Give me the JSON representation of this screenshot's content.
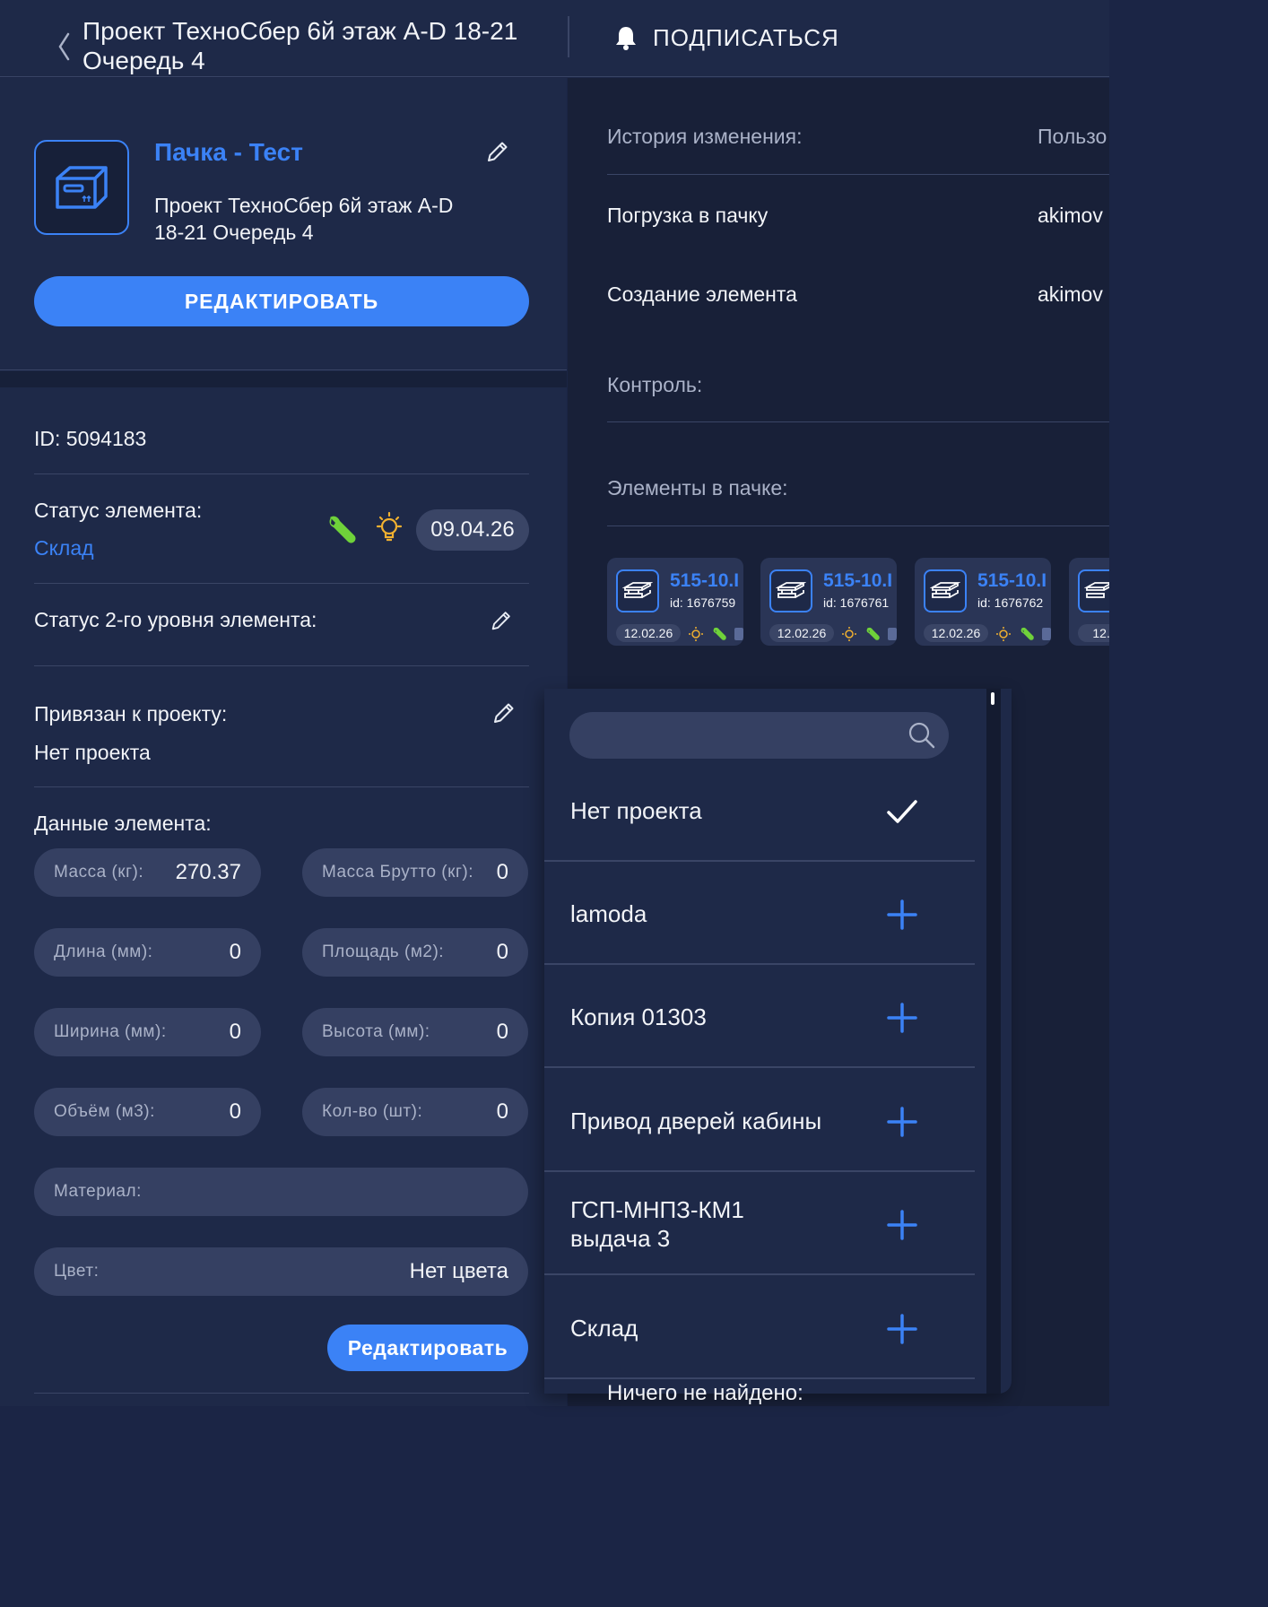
{
  "header": {
    "title_line1": "Проект ТехноСбер 6й этаж A-D 18-21",
    "title_line2": "Очередь 4",
    "subscribe_label": "ПОДПИСАТЬСЯ"
  },
  "element": {
    "name": "Пачка - Тест",
    "project_line1": "Проект ТехноСбер 6й этаж A-D",
    "project_line2": "18-21 Очередь 4",
    "edit_button": "РЕДАКТИРОВАТЬ",
    "id_text": "ID: 5094183",
    "status_label": "Статус элемента:",
    "status_value": "Склад",
    "status_date": "09.04.26",
    "status2_label": "Статус 2-го уровня элемента:",
    "project_bind_label": "Привязан к проекту:",
    "project_bind_value": "Нет проекта",
    "data_label": "Данные элемента:",
    "fields": [
      {
        "label": "Масса (кг):",
        "value": "270.37"
      },
      {
        "label": "Масса Брутто (кг):",
        "value": "0"
      },
      {
        "label": "Длина (мм):",
        "value": "0"
      },
      {
        "label": "Площадь (м2):",
        "value": "0"
      },
      {
        "label": "Ширина (мм):",
        "value": "0"
      },
      {
        "label": "Высота (мм):",
        "value": "0"
      },
      {
        "label": "Объём (м3):",
        "value": "0"
      },
      {
        "label": "Кол-во (шт):",
        "value": "0"
      }
    ],
    "material_label": "Материал:",
    "material_value": "",
    "color_label": "Цвет:",
    "color_value": "Нет цвета",
    "edit_small_button": "Редактировать"
  },
  "history": {
    "title": "История изменения:",
    "user_col": "Пользо",
    "rows": [
      {
        "action": "Погрузка в пачку",
        "user": "akimov"
      },
      {
        "action": "Создание элемента",
        "user": "akimov"
      }
    ],
    "control_label": "Контроль:",
    "elements_label": "Элементы в пачке:"
  },
  "cards": [
    {
      "name": "515-10.I",
      "id": "id: 1676759",
      "date": "12.02.26"
    },
    {
      "name": "515-10.I",
      "id": "id: 1676761",
      "date": "12.02.26"
    },
    {
      "name": "515-10.I",
      "id": "id: 1676762",
      "date": "12.02.26"
    },
    {
      "name": "",
      "id": "",
      "date": "12.0"
    }
  ],
  "dropdown": {
    "search_placeholder": "",
    "items": [
      {
        "label_line1": "Нет проекта",
        "label_line2": "",
        "selected": true
      },
      {
        "label_line1": "lamoda",
        "label_line2": "",
        "selected": false
      },
      {
        "label_line1": "Копия 01303",
        "label_line2": "",
        "selected": false
      },
      {
        "label_line1": "Привод дверей кабины",
        "label_line2": "",
        "selected": false
      },
      {
        "label_line1": "ГСП-МНПЗ-КМ1",
        "label_line2": "выдача 3",
        "selected": false
      },
      {
        "label_line1": "Склад",
        "label_line2": "",
        "selected": false
      }
    ],
    "nothing_found": "Ничего не найдено:"
  },
  "colors": {
    "accent": "#3b82f6",
    "background": "#1b2545",
    "wrench": "#6fd23a",
    "bulb": "#f0b030"
  }
}
